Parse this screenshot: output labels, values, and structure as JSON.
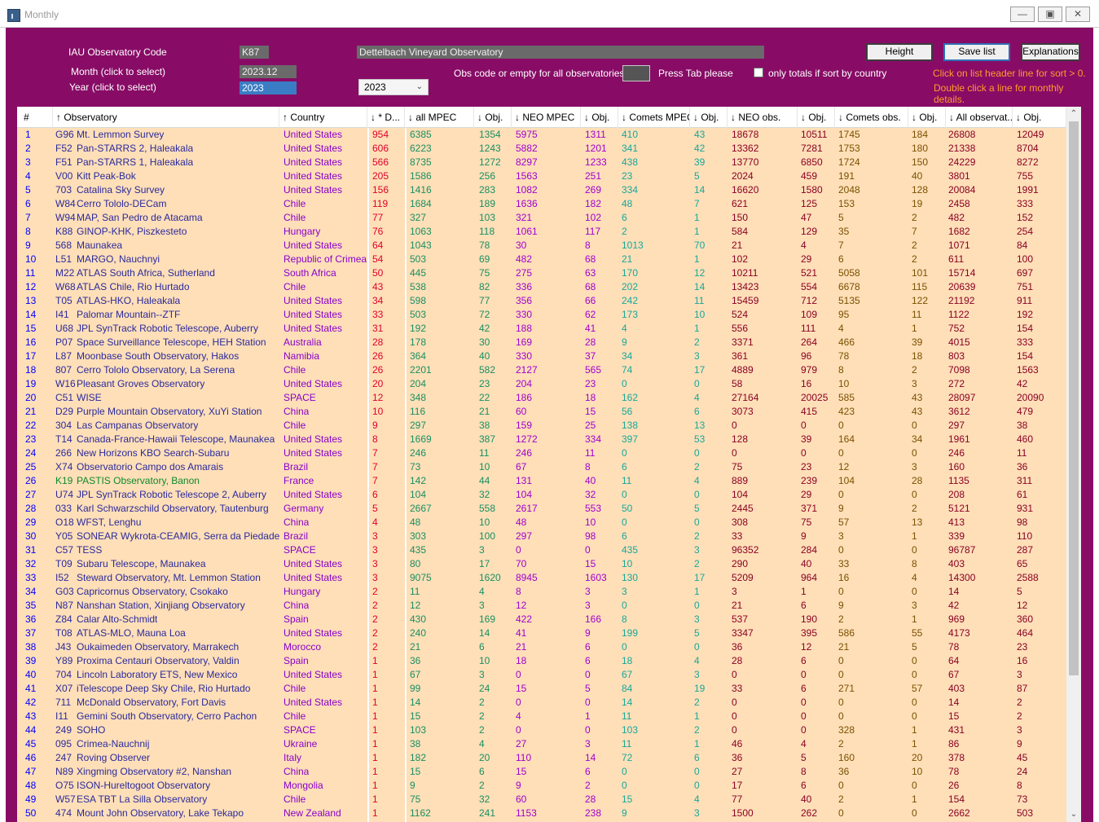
{
  "window": {
    "title": "Monthly"
  },
  "controls": {
    "iau_label": "IAU Observatory Code",
    "iau_code": "K87",
    "observatory_name": "Dettelbach Vineyard Observatory",
    "month_label": "Month (click to select)",
    "month_value": "2023.12",
    "year_label": "Year (click to select)",
    "year_value": "2023",
    "year_dropdown": "2023",
    "obs_code_label": "Obs code or empty for all observatories",
    "press_tab": "Press Tab please",
    "only_totals_label": "only totals if sort by country",
    "height_btn": "Height",
    "save_btn": "Save list",
    "explanations_btn": "Explanations",
    "hint1": "Click on list header line for sort > 0.",
    "hint2": "Double click a line for monthly details."
  },
  "colors": {
    "panel": "#880c66",
    "row_bg": "#ffdfb8",
    "num": "#0000ff",
    "code": "#2a2a9c",
    "country": "#8800cc",
    "d": "#e0002a",
    "green": "#188f62",
    "purple": "#a000d0",
    "teal": "#16a89a",
    "maroon": "#8a0024",
    "olive": "#7a5000",
    "hint": "#ff9a2c"
  },
  "table": {
    "headers": [
      "#",
      "↑ Observatory",
      "↑ Country",
      "↓ * D...",
      "↓ all MPEC",
      "↓ Obj.",
      "↓ NEO MPEC",
      "↓ Obj.",
      "↓ Comets MPEC",
      "↓ Obj.",
      "↓ NEO obs.",
      "↓ Obj.",
      "↓ Comets obs.",
      "↓ Obj.",
      "↓ All observat...",
      "↓ Obj."
    ],
    "rows": [
      [
        "1",
        "G96",
        "Mt. Lemmon Survey",
        "United States",
        "954",
        "6385",
        "1354",
        "5975",
        "1311",
        "410",
        "43",
        "18678",
        "10511",
        "1745",
        "184",
        "26808",
        "12049"
      ],
      [
        "2",
        "F52",
        "Pan-STARRS 2, Haleakala",
        "United States",
        "606",
        "6223",
        "1243",
        "5882",
        "1201",
        "341",
        "42",
        "13362",
        "7281",
        "1753",
        "180",
        "21338",
        "8704"
      ],
      [
        "3",
        "F51",
        "Pan-STARRS 1, Haleakala",
        "United States",
        "566",
        "8735",
        "1272",
        "8297",
        "1233",
        "438",
        "39",
        "13770",
        "6850",
        "1724",
        "150",
        "24229",
        "8272"
      ],
      [
        "4",
        "V00",
        "Kitt Peak-Bok",
        "United States",
        "205",
        "1586",
        "256",
        "1563",
        "251",
        "23",
        "5",
        "2024",
        "459",
        "191",
        "40",
        "3801",
        "755"
      ],
      [
        "5",
        "703",
        "Catalina Sky Survey",
        "United States",
        "156",
        "1416",
        "283",
        "1082",
        "269",
        "334",
        "14",
        "16620",
        "1580",
        "2048",
        "128",
        "20084",
        "1991"
      ],
      [
        "6",
        "W84",
        "Cerro Tololo-DECam",
        "Chile",
        "119",
        "1684",
        "189",
        "1636",
        "182",
        "48",
        "7",
        "621",
        "125",
        "153",
        "19",
        "2458",
        "333"
      ],
      [
        "7",
        "W94",
        "MAP, San Pedro de Atacama",
        "Chile",
        "77",
        "327",
        "103",
        "321",
        "102",
        "6",
        "1",
        "150",
        "47",
        "5",
        "2",
        "482",
        "152"
      ],
      [
        "8",
        "K88",
        "GINOP-KHK, Piszkesteto",
        "Hungary",
        "76",
        "1063",
        "118",
        "1061",
        "117",
        "2",
        "1",
        "584",
        "129",
        "35",
        "7",
        "1682",
        "254"
      ],
      [
        "9",
        "568",
        "Maunakea",
        "United States",
        "64",
        "1043",
        "78",
        "30",
        "8",
        "1013",
        "70",
        "21",
        "4",
        "7",
        "2",
        "1071",
        "84"
      ],
      [
        "10",
        "L51",
        "MARGO, Nauchnyi",
        "Republic of Crimea",
        "54",
        "503",
        "69",
        "482",
        "68",
        "21",
        "1",
        "102",
        "29",
        "6",
        "2",
        "611",
        "100"
      ],
      [
        "11",
        "M22",
        "ATLAS South Africa, Sutherland",
        "South Africa",
        "50",
        "445",
        "75",
        "275",
        "63",
        "170",
        "12",
        "10211",
        "521",
        "5058",
        "101",
        "15714",
        "697"
      ],
      [
        "12",
        "W68",
        "ATLAS Chile, Rio Hurtado",
        "Chile",
        "43",
        "538",
        "82",
        "336",
        "68",
        "202",
        "14",
        "13423",
        "554",
        "6678",
        "115",
        "20639",
        "751"
      ],
      [
        "13",
        "T05",
        "ATLAS-HKO, Haleakala",
        "United States",
        "34",
        "598",
        "77",
        "356",
        "66",
        "242",
        "11",
        "15459",
        "712",
        "5135",
        "122",
        "21192",
        "911"
      ],
      [
        "14",
        "I41",
        "Palomar Mountain--ZTF",
        "United States",
        "33",
        "503",
        "72",
        "330",
        "62",
        "173",
        "10",
        "524",
        "109",
        "95",
        "11",
        "1122",
        "192"
      ],
      [
        "15",
        "U68",
        "JPL SynTrack Robotic Telescope, Auberry",
        "United States",
        "31",
        "192",
        "42",
        "188",
        "41",
        "4",
        "1",
        "556",
        "111",
        "4",
        "1",
        "752",
        "154"
      ],
      [
        "16",
        "P07",
        "Space Surveillance Telescope, HEH Station",
        "Australia",
        "28",
        "178",
        "30",
        "169",
        "28",
        "9",
        "2",
        "3371",
        "264",
        "466",
        "39",
        "4015",
        "333"
      ],
      [
        "17",
        "L87",
        "Moonbase South Observatory, Hakos",
        "Namibia",
        "26",
        "364",
        "40",
        "330",
        "37",
        "34",
        "3",
        "361",
        "96",
        "78",
        "18",
        "803",
        "154"
      ],
      [
        "18",
        "807",
        "Cerro Tololo Observatory, La Serena",
        "Chile",
        "26",
        "2201",
        "582",
        "2127",
        "565",
        "74",
        "17",
        "4889",
        "979",
        "8",
        "2",
        "7098",
        "1563"
      ],
      [
        "19",
        "W16",
        "Pleasant Groves Observatory",
        "United States",
        "20",
        "204",
        "23",
        "204",
        "23",
        "0",
        "0",
        "58",
        "16",
        "10",
        "3",
        "272",
        "42"
      ],
      [
        "20",
        "C51",
        "WISE",
        "SPACE",
        "12",
        "348",
        "22",
        "186",
        "18",
        "162",
        "4",
        "27164",
        "20025",
        "585",
        "43",
        "28097",
        "20090"
      ],
      [
        "21",
        "D29",
        "Purple Mountain Observatory, XuYi Station",
        "China",
        "10",
        "116",
        "21",
        "60",
        "15",
        "56",
        "6",
        "3073",
        "415",
        "423",
        "43",
        "3612",
        "479"
      ],
      [
        "22",
        "304",
        "Las Campanas Observatory",
        "Chile",
        "9",
        "297",
        "38",
        "159",
        "25",
        "138",
        "13",
        "0",
        "0",
        "0",
        "0",
        "297",
        "38"
      ],
      [
        "23",
        "T14",
        "Canada-France-Hawaii Telescope, Maunakea",
        "United States",
        "8",
        "1669",
        "387",
        "1272",
        "334",
        "397",
        "53",
        "128",
        "39",
        "164",
        "34",
        "1961",
        "460"
      ],
      [
        "24",
        "266",
        "New Horizons KBO Search-Subaru",
        "United States",
        "7",
        "246",
        "11",
        "246",
        "11",
        "0",
        "0",
        "0",
        "0",
        "0",
        "0",
        "246",
        "11"
      ],
      [
        "25",
        "X74",
        "Observatorio Campo dos Amarais",
        "Brazil",
        "7",
        "73",
        "10",
        "67",
        "8",
        "6",
        "2",
        "75",
        "23",
        "12",
        "3",
        "160",
        "36"
      ],
      [
        "26",
        "K19",
        "PASTIS Observatory, Banon",
        "France",
        "7",
        "142",
        "44",
        "131",
        "40",
        "11",
        "4",
        "889",
        "239",
        "104",
        "28",
        "1135",
        "311"
      ],
      [
        "27",
        "U74",
        "JPL SynTrack Robotic Telescope 2, Auberry",
        "United States",
        "6",
        "104",
        "32",
        "104",
        "32",
        "0",
        "0",
        "104",
        "29",
        "0",
        "0",
        "208",
        "61"
      ],
      [
        "28",
        "033",
        "Karl Schwarzschild Observatory, Tautenburg",
        "Germany",
        "5",
        "2667",
        "558",
        "2617",
        "553",
        "50",
        "5",
        "2445",
        "371",
        "9",
        "2",
        "5121",
        "931"
      ],
      [
        "29",
        "O18",
        "WFST, Lenghu",
        "China",
        "4",
        "48",
        "10",
        "48",
        "10",
        "0",
        "0",
        "308",
        "75",
        "57",
        "13",
        "413",
        "98"
      ],
      [
        "30",
        "Y05",
        "SONEAR Wykrota-CEAMIG, Serra da Piedade",
        "Brazil",
        "3",
        "303",
        "100",
        "297",
        "98",
        "6",
        "2",
        "33",
        "9",
        "3",
        "1",
        "339",
        "110"
      ],
      [
        "31",
        "C57",
        "TESS",
        "SPACE",
        "3",
        "435",
        "3",
        "0",
        "0",
        "435",
        "3",
        "96352",
        "284",
        "0",
        "0",
        "96787",
        "287"
      ],
      [
        "32",
        "T09",
        "Subaru Telescope, Maunakea",
        "United States",
        "3",
        "80",
        "17",
        "70",
        "15",
        "10",
        "2",
        "290",
        "40",
        "33",
        "8",
        "403",
        "65"
      ],
      [
        "33",
        "I52",
        "Steward Observatory, Mt. Lemmon Station",
        "United States",
        "3",
        "9075",
        "1620",
        "8945",
        "1603",
        "130",
        "17",
        "5209",
        "964",
        "16",
        "4",
        "14300",
        "2588"
      ],
      [
        "34",
        "G03",
        "Capricornus Observatory, Csokako",
        "Hungary",
        "2",
        "11",
        "4",
        "8",
        "3",
        "3",
        "1",
        "3",
        "1",
        "0",
        "0",
        "14",
        "5"
      ],
      [
        "35",
        "N87",
        "Nanshan Station, Xinjiang Observatory",
        "China",
        "2",
        "12",
        "3",
        "12",
        "3",
        "0",
        "0",
        "21",
        "6",
        "9",
        "3",
        "42",
        "12"
      ],
      [
        "36",
        "Z84",
        "Calar Alto-Schmidt",
        "Spain",
        "2",
        "430",
        "169",
        "422",
        "166",
        "8",
        "3",
        "537",
        "190",
        "2",
        "1",
        "969",
        "360"
      ],
      [
        "37",
        "T08",
        "ATLAS-MLO, Mauna Loa",
        "United States",
        "2",
        "240",
        "14",
        "41",
        "9",
        "199",
        "5",
        "3347",
        "395",
        "586",
        "55",
        "4173",
        "464"
      ],
      [
        "38",
        "J43",
        "Oukaimeden Observatory, Marrakech",
        "Morocco",
        "2",
        "21",
        "6",
        "21",
        "6",
        "0",
        "0",
        "36",
        "12",
        "21",
        "5",
        "78",
        "23"
      ],
      [
        "39",
        "Y89",
        "Proxima Centauri Observatory, Valdin",
        "Spain",
        "1",
        "36",
        "10",
        "18",
        "6",
        "18",
        "4",
        "28",
        "6",
        "0",
        "0",
        "64",
        "16"
      ],
      [
        "40",
        "704",
        "Lincoln Laboratory ETS, New Mexico",
        "United States",
        "1",
        "67",
        "3",
        "0",
        "0",
        "67",
        "3",
        "0",
        "0",
        "0",
        "0",
        "67",
        "3"
      ],
      [
        "41",
        "X07",
        "iTelescope Deep Sky Chile, Rio Hurtado",
        "Chile",
        "1",
        "99",
        "24",
        "15",
        "5",
        "84",
        "19",
        "33",
        "6",
        "271",
        "57",
        "403",
        "87"
      ],
      [
        "42",
        "711",
        "McDonald Observatory, Fort Davis",
        "United States",
        "1",
        "14",
        "2",
        "0",
        "0",
        "14",
        "2",
        "0",
        "0",
        "0",
        "0",
        "14",
        "2"
      ],
      [
        "43",
        "I11",
        "Gemini South Observatory, Cerro Pachon",
        "Chile",
        "1",
        "15",
        "2",
        "4",
        "1",
        "11",
        "1",
        "0",
        "0",
        "0",
        "0",
        "15",
        "2"
      ],
      [
        "44",
        "249",
        "SOHO",
        "SPACE",
        "1",
        "103",
        "2",
        "0",
        "0",
        "103",
        "2",
        "0",
        "0",
        "328",
        "1",
        "431",
        "3"
      ],
      [
        "45",
        "095",
        "Crimea-Nauchnij",
        "Ukraine",
        "1",
        "38",
        "4",
        "27",
        "3",
        "11",
        "1",
        "46",
        "4",
        "2",
        "1",
        "86",
        "9"
      ],
      [
        "46",
        "247",
        "Roving Observer",
        "Italy",
        "1",
        "182",
        "20",
        "110",
        "14",
        "72",
        "6",
        "36",
        "5",
        "160",
        "20",
        "378",
        "45"
      ],
      [
        "47",
        "N89",
        "Xingming Observatory #2, Nanshan",
        "China",
        "1",
        "15",
        "6",
        "15",
        "6",
        "0",
        "0",
        "27",
        "8",
        "36",
        "10",
        "78",
        "24"
      ],
      [
        "48",
        "O75",
        "ISON-Hureltogoot Observatory",
        "Mongolia",
        "1",
        "9",
        "2",
        "9",
        "2",
        "0",
        "0",
        "17",
        "6",
        "0",
        "0",
        "26",
        "8"
      ],
      [
        "49",
        "W57",
        "ESA TBT La Silla Observatory",
        "Chile",
        "1",
        "75",
        "32",
        "60",
        "28",
        "15",
        "4",
        "77",
        "40",
        "2",
        "1",
        "154",
        "73"
      ],
      [
        "50",
        "474",
        "Mount John Observatory, Lake Tekapo",
        "New Zealand",
        "1",
        "1162",
        "241",
        "1153",
        "238",
        "9",
        "3",
        "1500",
        "262",
        "0",
        "0",
        "2662",
        "503"
      ]
    ]
  }
}
